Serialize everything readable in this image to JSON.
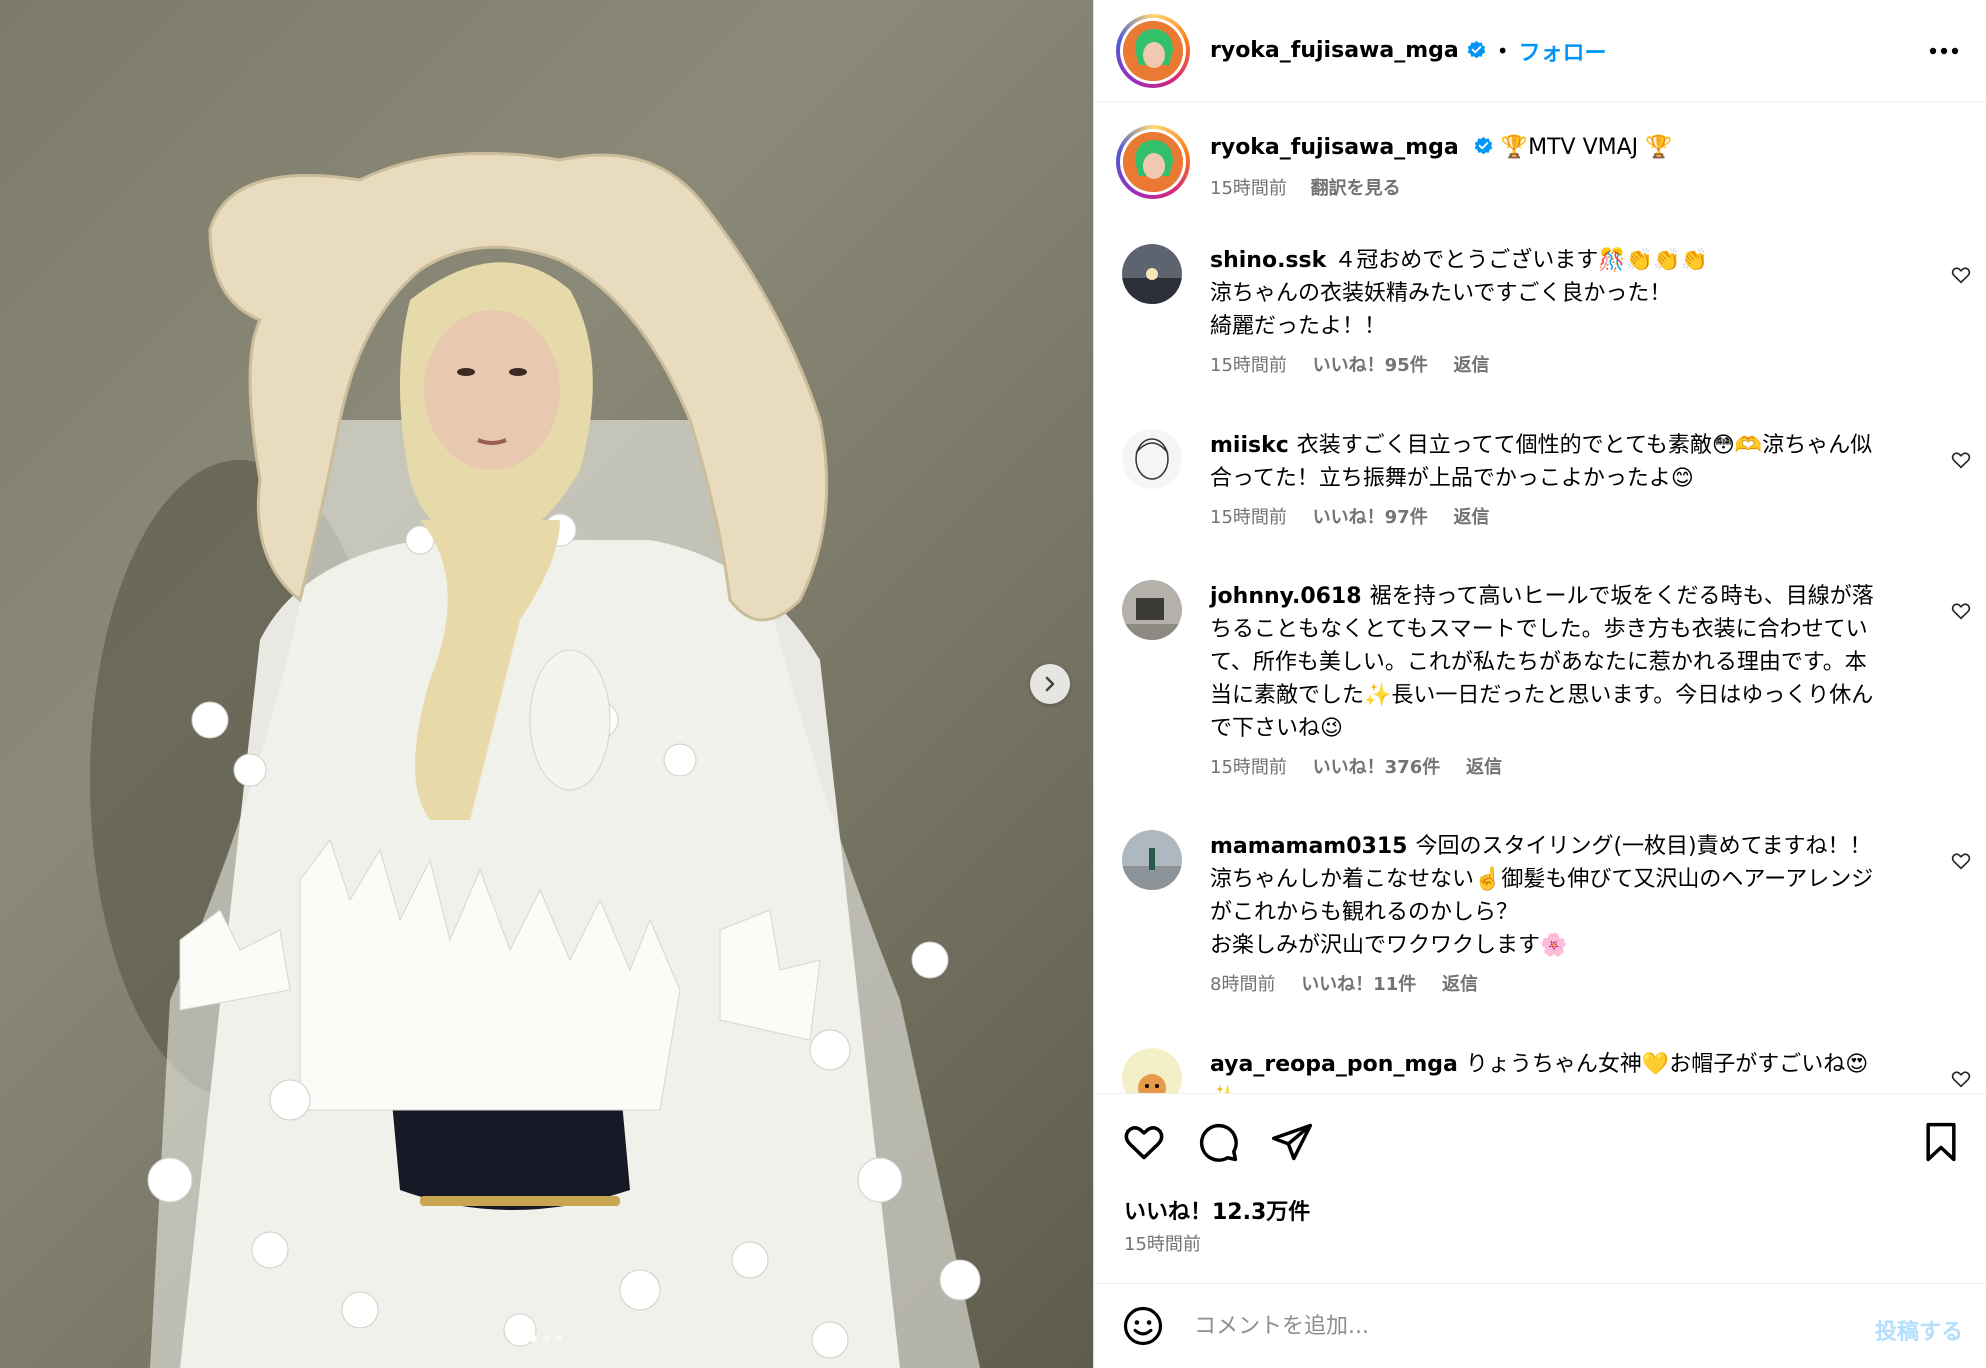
{
  "post": {
    "image_alt": "Person wearing a wide cream woven hat, silk headscarf and white veil covered with white petal appliqués",
    "carousel_dots": 3,
    "active_dot": 0
  },
  "header": {
    "username": "ryoka_fujisawa_mga",
    "separator": "•",
    "follow_label": "フォロー"
  },
  "caption": {
    "username": "ryoka_fujisawa_mga",
    "text": "🏆MTV VMAJ 🏆",
    "time": "15時間前",
    "translate_label": "翻訳を見る"
  },
  "comments": [
    {
      "username": "shino.ssk",
      "lines": [
        "４冠おめでとうございます🎊👏👏👏",
        "涼ちゃんの衣装妖精みたいですごく良かった！",
        "綺麗だったよ！！"
      ],
      "time": "15時間前",
      "likes": "いいね！95件",
      "reply": "返信"
    },
    {
      "username": "miiskc",
      "lines": [
        "衣装すごく目立ってて個性的でとても素敵😳🫶涼ちゃん似",
        "合ってた！立ち振舞が上品でかっこよかったよ😊"
      ],
      "time": "15時間前",
      "likes": "いいね！97件",
      "reply": "返信"
    },
    {
      "username": "johnny.0618",
      "lines": [
        "裾を持って高いヒールで坂をくだる時も、目線が落",
        "ちることもなくとてもスマートでした。歩き方も衣装に合わせてい",
        "て、所作も美しい。これが私たちがあなたに惹かれる理由です。本",
        "当に素敵でした✨長い一日だったと思います。今日はゆっくり休ん",
        "で下さいね😉"
      ],
      "time": "15時間前",
      "likes": "いいね！376件",
      "reply": "返信"
    },
    {
      "username": "mamamam0315",
      "lines": [
        "今回のスタイリング(一枚目)責めてますね！！",
        "涼ちゃんしか着こなせない☝️御髪も伸びて又沢山のヘアーアレンジ",
        "がこれからも観れるのかしら？",
        "お楽しみが沢山でワクワクします🌸"
      ],
      "time": "8時間前",
      "likes": "いいね！11件",
      "reply": "返信"
    },
    {
      "username": "aya_reopa_pon_mga",
      "lines": [
        "りょうちゃん女神💛お帽子がすごいね😍",
        "✨"
      ],
      "time": "",
      "likes": "",
      "reply": ""
    }
  ],
  "footer": {
    "likes": "いいね！12.3万件",
    "time": "15時間前",
    "comment_placeholder": "コメントを追加...",
    "post_label": "投稿する"
  },
  "colors": {
    "link_blue": "#0095f6",
    "muted": "#737373",
    "post_disabled": "#b2dffc"
  }
}
